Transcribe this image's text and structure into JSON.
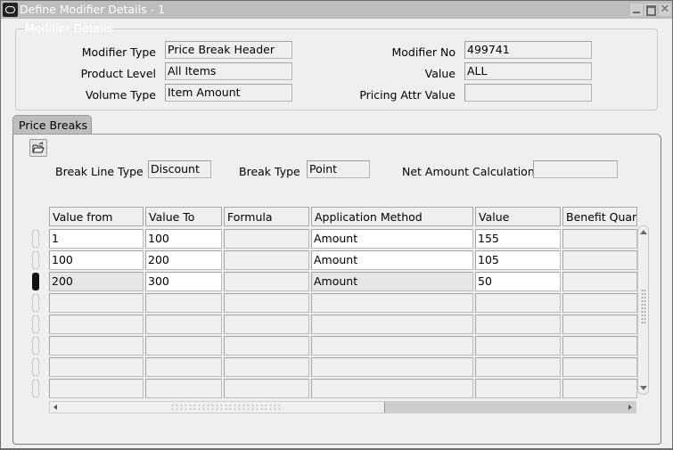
{
  "window": {
    "title": "Define Modifier Details - 1",
    "icons": {
      "app": "oracle-app-icon",
      "minimize": "minimize-icon",
      "maximize": "maximize-icon",
      "close": "close-icon"
    },
    "close_glyph": "✕"
  },
  "modifier_details": {
    "legend": "Modifier Details",
    "modifier_type": {
      "label": "Modifier Type",
      "value": "Price Break Header"
    },
    "product_level": {
      "label": "Product  Level",
      "value": "All Items"
    },
    "volume_type": {
      "label": "Volume Type",
      "value": "Item Amount"
    },
    "modifier_no": {
      "label": "Modifier No",
      "value": "499741"
    },
    "value": {
      "label": "Value",
      "value": "ALL"
    },
    "pricing_attr_value": {
      "label": "Pricing Attr Value",
      "value": ""
    }
  },
  "tabs": [
    {
      "label": "Price Breaks",
      "selected": true
    }
  ],
  "price_breaks": {
    "toolbar_icon": "open-folder-icon",
    "break_line_type": {
      "label": "Break Line Type",
      "value": "Discount"
    },
    "break_type": {
      "label": "Break Type",
      "value": "Point"
    },
    "net_amount_calculation": {
      "label": "Net Amount Calculation",
      "value": ""
    },
    "columns": [
      "Value from",
      "Value To",
      "Formula",
      "Application Method",
      "Value",
      "Benefit Quant"
    ],
    "rows": [
      [
        "1",
        "100",
        "",
        "Amount",
        "155",
        ""
      ],
      [
        "100",
        "200",
        "",
        "Amount",
        "105",
        ""
      ],
      [
        "200",
        "300",
        "",
        "Amount",
        "50",
        ""
      ],
      [
        "",
        "",
        "",
        "",
        "",
        ""
      ],
      [
        "",
        "",
        "",
        "",
        "",
        ""
      ],
      [
        "",
        "",
        "",
        "",
        "",
        ""
      ],
      [
        "",
        "",
        "",
        "",
        "",
        ""
      ],
      [
        "",
        "",
        "",
        "",
        "",
        ""
      ]
    ],
    "current_row": 3
  }
}
